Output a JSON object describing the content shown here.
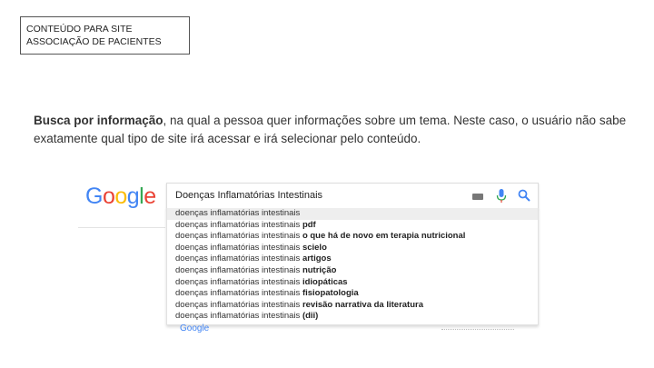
{
  "title_box": {
    "line1": "CONTEÚDO PARA SITE",
    "line2": "ASSOCIAÇÃO DE PACIENTES"
  },
  "description": {
    "bold": "Busca por informação",
    "rest": ", na qual a pessoa quer informações sobre um tema. Neste caso, o usuário não sabe exatamente qual tipo de site irá acessar e irá selecionar pelo conteúdo."
  },
  "google": {
    "logo_letters": [
      "G",
      "o",
      "o",
      "g",
      "l",
      "e"
    ],
    "query": "Doenças Inflamatórias Intestinais",
    "suggestions": [
      {
        "base": "doenças inflamatórias intestinais",
        "suffix": ""
      },
      {
        "base": "doenças inflamatórias intestinais",
        "suffix": "pdf"
      },
      {
        "base": "doenças inflamatórias intestinais",
        "suffix": "o que há de novo em terapia nutricional"
      },
      {
        "base": "doenças inflamatórias intestinais",
        "suffix": "scielo"
      },
      {
        "base": "doenças inflamatórias intestinais",
        "suffix": "artigos"
      },
      {
        "base": "doenças inflamatórias intestinais",
        "suffix": "nutrição"
      },
      {
        "base": "doenças inflamatórias intestinais",
        "suffix": "idiopáticas"
      },
      {
        "base": "doenças inflamatórias intestinais",
        "suffix": "fisiopatologia"
      },
      {
        "base": "doenças inflamatórias intestinais",
        "suffix": "revisão narrativa da literatura"
      },
      {
        "base": "doenças inflamatórias intestinais",
        "suffix": "(dii)"
      }
    ],
    "footer_logo": "Google",
    "icons": {
      "keyboard": "keyboard-icon",
      "mic": "microphone-icon",
      "search": "search-icon"
    },
    "colors": {
      "blue": "#4285f4",
      "red": "#ea4335",
      "yellow": "#fbbc05",
      "green": "#34a853"
    }
  }
}
